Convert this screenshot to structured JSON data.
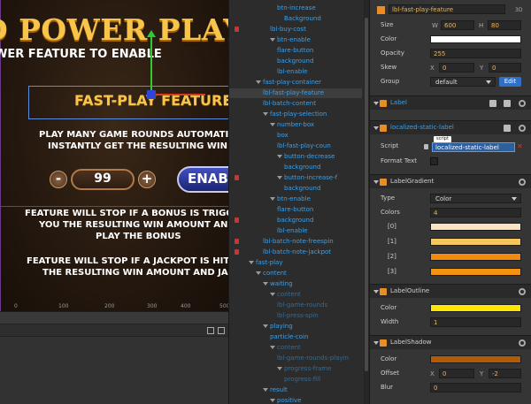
{
  "scene": {
    "banner": "D POWER PLAY!",
    "subbanner": "WER FEATURE TO ENABLE",
    "feature_title": "FAST-PLAY FEATURE",
    "desc_lines": [
      "PLAY MANY GAME ROUNDS AUTOMATICAL",
      "INSTANTLY GET THE RESULTING WIN AM",
      "FEATURE WILL STOP IF A BONUS IS TRIGGERED",
      "YOU THE RESULTING WIN AMOUNT AND LET",
      "PLAY THE BONUS",
      "FEATURE WILL STOP IF A JACKPOT IS HIT, SHO",
      "THE RESULTING WIN AMOUNT AND JACKP"
    ],
    "counter_value": "99",
    "minus_label": "-",
    "plus_label": "+",
    "enable_label": "ENAB",
    "ruler_ticks": [
      "0",
      "100",
      "200",
      "300",
      "400",
      "500"
    ]
  },
  "tree": {
    "rows": [
      {
        "label": "btn-increase",
        "indent": 5,
        "lock": false,
        "state": "normal"
      },
      {
        "label": "Background",
        "indent": 6,
        "lock": false,
        "state": "normal"
      },
      {
        "label": "lbl-buy-cost",
        "indent": 4,
        "lock": true,
        "state": "normal"
      },
      {
        "label": "btn-enable",
        "indent": 4,
        "lock": false,
        "state": "normal",
        "caret": true
      },
      {
        "label": "flare-button",
        "indent": 5,
        "lock": false,
        "state": "normal"
      },
      {
        "label": "background",
        "indent": 5,
        "lock": false,
        "state": "normal"
      },
      {
        "label": "lbl-enable",
        "indent": 5,
        "lock": false,
        "state": "normal"
      },
      {
        "label": "fast-play-container",
        "indent": 2,
        "lock": false,
        "state": "normal",
        "caret": true
      },
      {
        "label": "lbl-fast-play-feature",
        "indent": 3,
        "lock": false,
        "state": "selected"
      },
      {
        "label": "lbl-batch-content",
        "indent": 3,
        "lock": false,
        "state": "normal"
      },
      {
        "label": "fast-play-selection",
        "indent": 3,
        "lock": false,
        "state": "normal",
        "caret": true
      },
      {
        "label": "number-box",
        "indent": 4,
        "lock": false,
        "state": "normal",
        "caret": true
      },
      {
        "label": "box",
        "indent": 5,
        "lock": false,
        "state": "normal"
      },
      {
        "label": "lbl-fast-play-coun",
        "indent": 5,
        "lock": false,
        "state": "normal"
      },
      {
        "label": "button-decrease",
        "indent": 5,
        "lock": false,
        "state": "normal",
        "caret": true
      },
      {
        "label": "background",
        "indent": 6,
        "lock": false,
        "state": "normal"
      },
      {
        "label": "button-increase-f",
        "indent": 5,
        "lock": true,
        "state": "normal",
        "caret": true
      },
      {
        "label": "background",
        "indent": 6,
        "lock": false,
        "state": "normal"
      },
      {
        "label": "btn-enable",
        "indent": 4,
        "lock": false,
        "state": "normal",
        "caret": true
      },
      {
        "label": "flare-button",
        "indent": 5,
        "lock": false,
        "state": "normal"
      },
      {
        "label": "background",
        "indent": 5,
        "lock": true,
        "state": "normal"
      },
      {
        "label": "lbl-enable",
        "indent": 5,
        "lock": false,
        "state": "normal"
      },
      {
        "label": "lbl-batch-note-freespin",
        "indent": 3,
        "lock": true,
        "state": "normal"
      },
      {
        "label": "lbl-batch-note-jackpot",
        "indent": 3,
        "lock": true,
        "state": "normal"
      },
      {
        "label": "fast-play",
        "indent": 1,
        "lock": false,
        "state": "normal",
        "caret": true
      },
      {
        "label": "content",
        "indent": 2,
        "lock": false,
        "state": "normal",
        "caret": true
      },
      {
        "label": "waiting",
        "indent": 3,
        "lock": false,
        "state": "normal",
        "caret": true
      },
      {
        "label": "content",
        "indent": 4,
        "lock": false,
        "state": "dim",
        "caret": true
      },
      {
        "label": "lbl-game-rounds",
        "indent": 5,
        "lock": false,
        "state": "dim"
      },
      {
        "label": "lbl-press-spin",
        "indent": 5,
        "lock": false,
        "state": "dim"
      },
      {
        "label": "playing",
        "indent": 3,
        "lock": false,
        "state": "normal",
        "caret": true
      },
      {
        "label": "particle-coin",
        "indent": 4,
        "lock": false,
        "state": "normal"
      },
      {
        "label": "content",
        "indent": 4,
        "lock": false,
        "state": "dim",
        "caret": true
      },
      {
        "label": "lbl-game-rounds-playin",
        "indent": 5,
        "lock": false,
        "state": "dim"
      },
      {
        "label": "progress-frame",
        "indent": 5,
        "lock": false,
        "state": "dim",
        "caret": true
      },
      {
        "label": "progress-fill",
        "indent": 6,
        "lock": false,
        "state": "dim"
      },
      {
        "label": "result",
        "indent": 3,
        "lock": false,
        "state": "normal",
        "caret": true
      },
      {
        "label": "positive",
        "indent": 4,
        "lock": false,
        "state": "normal",
        "caret": true
      }
    ]
  },
  "inspector": {
    "node_name": "lbl-fast-play-feature",
    "node_tag": "3D",
    "size_label": "Size",
    "size_w_label": "W",
    "size_w": "600",
    "size_h_label": "H",
    "size_h": "80",
    "color_label": "Color",
    "color_value": "#ffffff",
    "opacity_label": "Opacity",
    "opacity": "255",
    "skew_label": "Skew",
    "skew_x_label": "X",
    "skew_x": "0",
    "skew_y_label": "Y",
    "skew_y": "0",
    "group_label": "Group",
    "group_value": "default",
    "edit_label": "Edit",
    "label_section": "Label",
    "localized_section": "localized-static-label",
    "script_label": "Script",
    "script_value": "localized-static-label",
    "script_tag": "script",
    "format_text_label": "Format Text",
    "gradient_section": "LabelGradient",
    "type_label": "Type",
    "type_value": "Color",
    "colors_label": "Colors",
    "colors_count": "4",
    "color_items": [
      {
        "index": "[0]",
        "color": "#fbe3c2"
      },
      {
        "index": "[1]",
        "color": "#f5c65c"
      },
      {
        "index": "[2]",
        "color": "#f28a10"
      },
      {
        "index": "[3]",
        "color": "#f2920e"
      }
    ],
    "outline_section": "LabelOutline",
    "outline_color_label": "Color",
    "outline_color": "#ffe600",
    "width_label": "Width",
    "outline_width": "1",
    "shadow_section": "LabelShadow",
    "shadow_color_label": "Color",
    "shadow_color": "#b35a05",
    "offset_label": "Offset",
    "offset_x_label": "X",
    "offset_x": "0",
    "offset_y_label": "Y",
    "offset_y": "-2",
    "blur_label": "Blur",
    "blur": "0"
  }
}
